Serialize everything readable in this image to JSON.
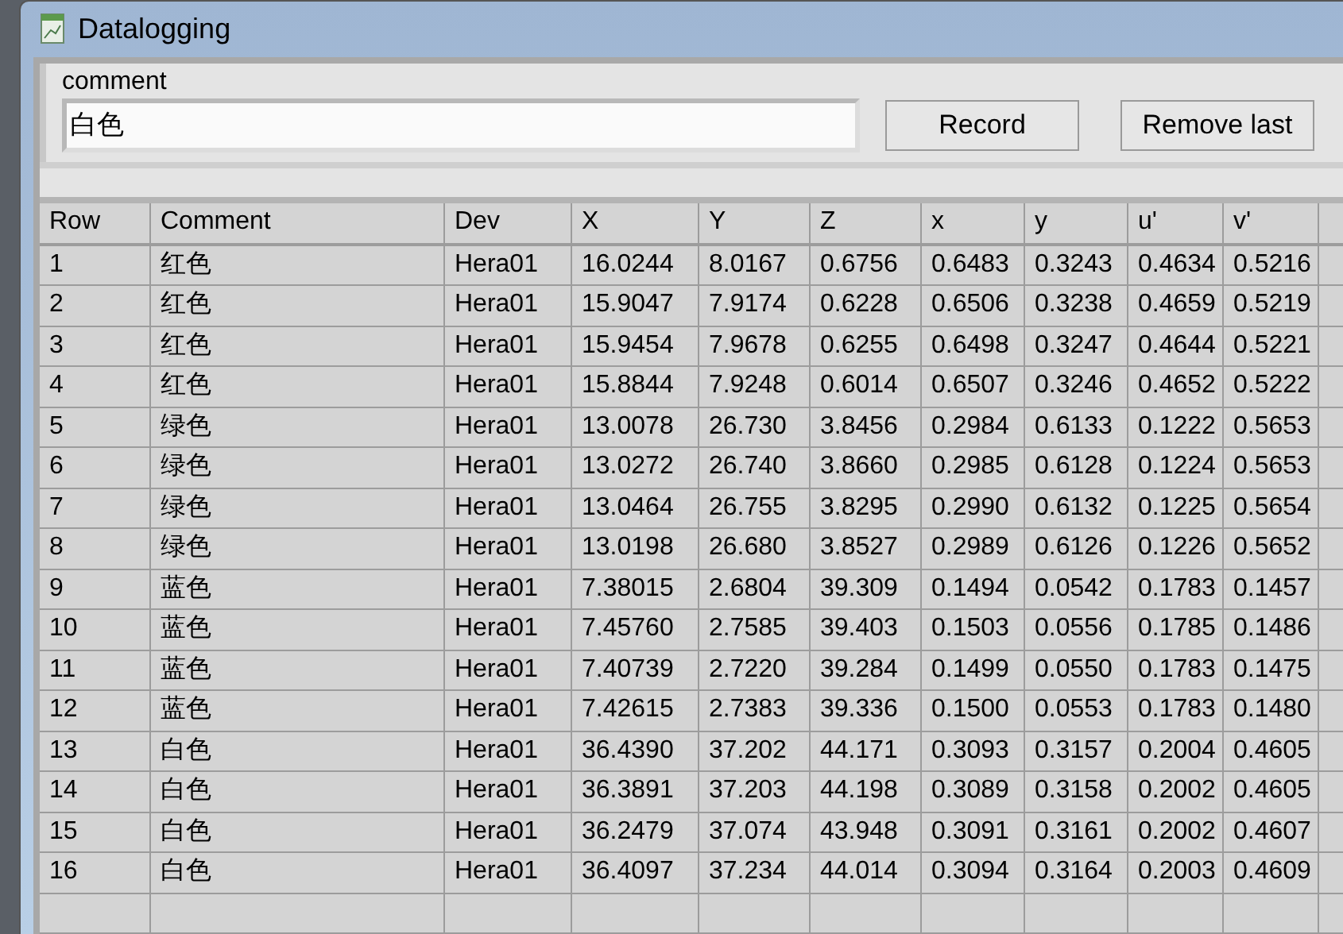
{
  "window": {
    "title": "Datalogging"
  },
  "comment": {
    "label": "comment",
    "value": "白色"
  },
  "buttons": [
    {
      "label": "Record"
    },
    {
      "label": "Remove last"
    }
  ],
  "table": {
    "columns": [
      "Row",
      "Comment",
      "Dev",
      "X",
      "Y",
      "Z",
      "x",
      "y",
      "u'",
      "v'"
    ],
    "rows": [
      [
        "1",
        "红色",
        "Hera01",
        "16.0244",
        "8.0167",
        "0.6756",
        "0.6483",
        "0.3243",
        "0.4634",
        "0.5216"
      ],
      [
        "2",
        "红色",
        "Hera01",
        "15.9047",
        "7.9174",
        "0.6228",
        "0.6506",
        "0.3238",
        "0.4659",
        "0.5219"
      ],
      [
        "3",
        "红色",
        "Hera01",
        "15.9454",
        "7.9678",
        "0.6255",
        "0.6498",
        "0.3247",
        "0.4644",
        "0.5221"
      ],
      [
        "4",
        "红色",
        "Hera01",
        "15.8844",
        "7.9248",
        "0.6014",
        "0.6507",
        "0.3246",
        "0.4652",
        "0.5222"
      ],
      [
        "5",
        "绿色",
        "Hera01",
        "13.0078",
        "26.730",
        "3.8456",
        "0.2984",
        "0.6133",
        "0.1222",
        "0.5653"
      ],
      [
        "6",
        "绿色",
        "Hera01",
        "13.0272",
        "26.740",
        "3.8660",
        "0.2985",
        "0.6128",
        "0.1224",
        "0.5653"
      ],
      [
        "7",
        "绿色",
        "Hera01",
        "13.0464",
        "26.755",
        "3.8295",
        "0.2990",
        "0.6132",
        "0.1225",
        "0.5654"
      ],
      [
        "8",
        "绿色",
        "Hera01",
        "13.0198",
        "26.680",
        "3.8527",
        "0.2989",
        "0.6126",
        "0.1226",
        "0.5652"
      ],
      [
        "9",
        "蓝色",
        "Hera01",
        "7.38015",
        "2.6804",
        "39.309",
        "0.1494",
        "0.0542",
        "0.1783",
        "0.1457"
      ],
      [
        "10",
        "蓝色",
        "Hera01",
        "7.45760",
        "2.7585",
        "39.403",
        "0.1503",
        "0.0556",
        "0.1785",
        "0.1486"
      ],
      [
        "11",
        "蓝色",
        "Hera01",
        "7.40739",
        "2.7220",
        "39.284",
        "0.1499",
        "0.0550",
        "0.1783",
        "0.1475"
      ],
      [
        "12",
        "蓝色",
        "Hera01",
        "7.42615",
        "2.7383",
        "39.336",
        "0.1500",
        "0.0553",
        "0.1783",
        "0.1480"
      ],
      [
        "13",
        "白色",
        "Hera01",
        "36.4390",
        "37.202",
        "44.171",
        "0.3093",
        "0.3157",
        "0.2004",
        "0.4605"
      ],
      [
        "14",
        "白色",
        "Hera01",
        "36.3891",
        "37.203",
        "44.198",
        "0.3089",
        "0.3158",
        "0.2002",
        "0.4605"
      ],
      [
        "15",
        "白色",
        "Hera01",
        "36.2479",
        "37.074",
        "43.948",
        "0.3091",
        "0.3161",
        "0.2002",
        "0.4607"
      ],
      [
        "16",
        "白色",
        "Hera01",
        "36.4097",
        "37.234",
        "44.014",
        "0.3094",
        "0.3164",
        "0.2003",
        "0.4609"
      ]
    ]
  }
}
